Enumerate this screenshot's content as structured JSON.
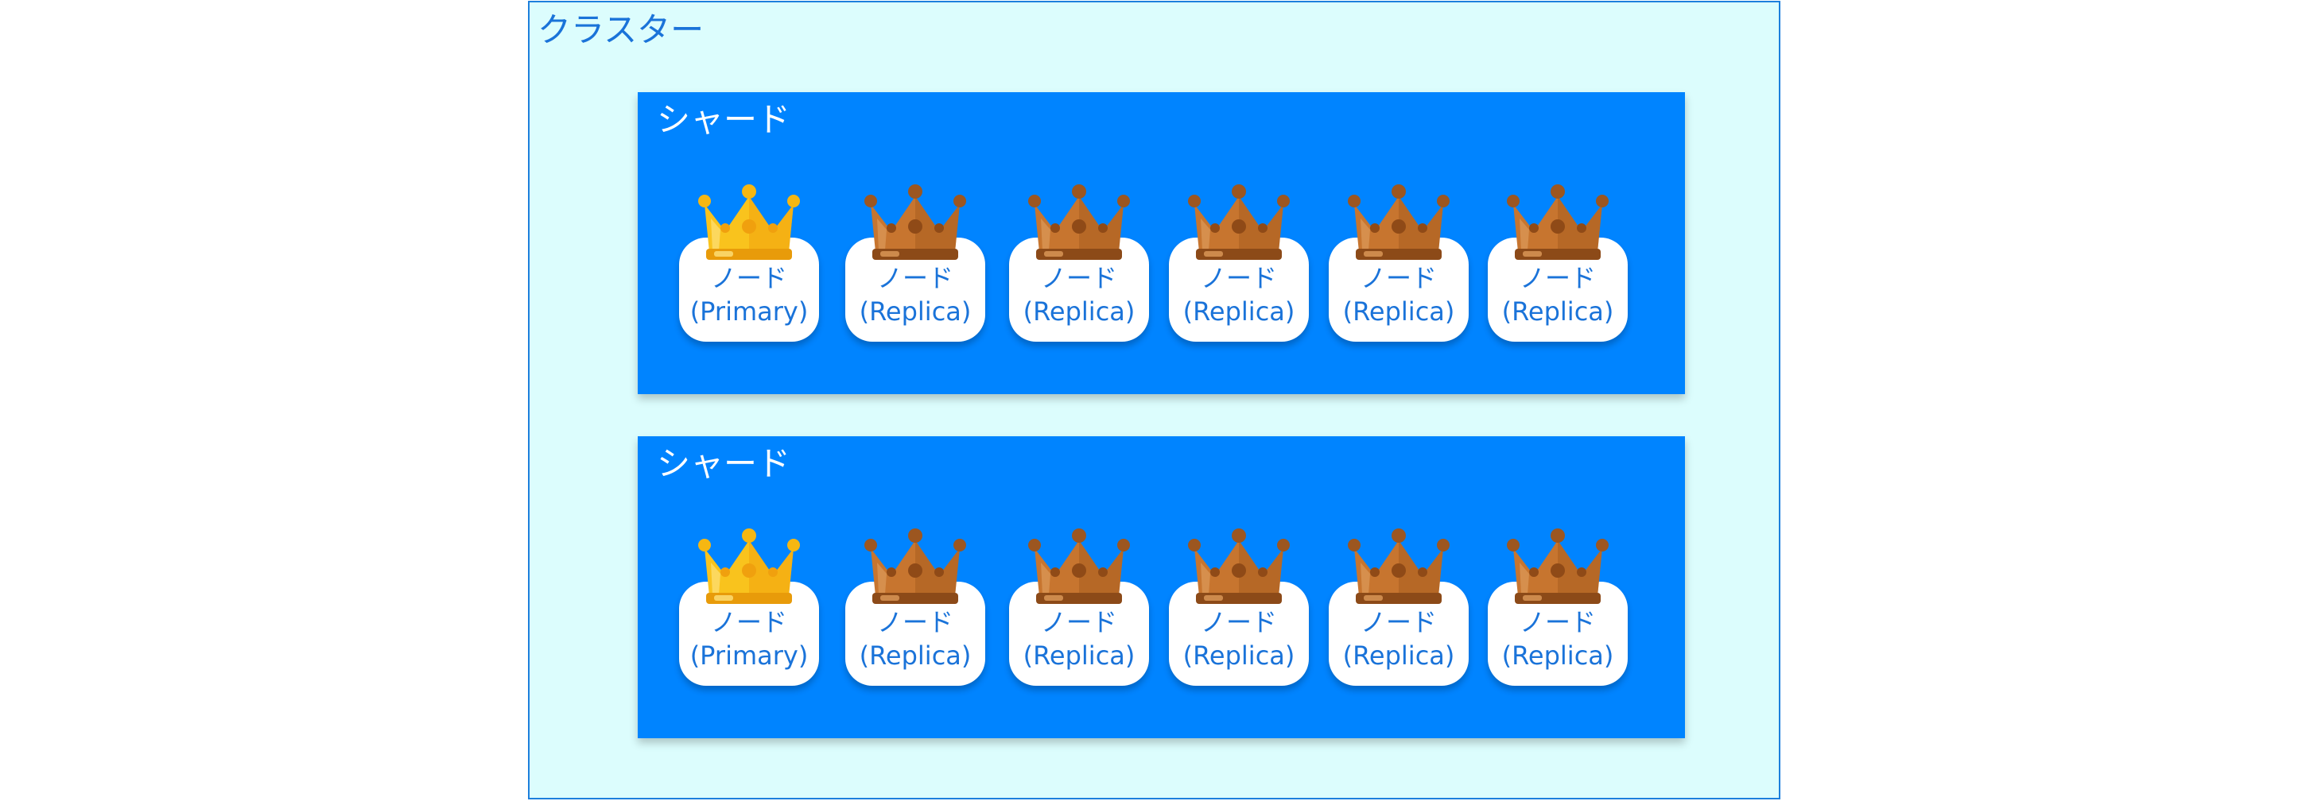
{
  "cluster": {
    "label": "クラスター"
  },
  "shards": [
    {
      "label": "シャード",
      "nodes": [
        {
          "line1": "ノード",
          "line2": "(Primary)",
          "role": "primary",
          "crown_icon": "gold-crown-icon"
        },
        {
          "line1": "ノード",
          "line2": "(Replica)",
          "role": "replica",
          "crown_icon": "bronze-crown-icon"
        },
        {
          "line1": "ノード",
          "line2": "(Replica)",
          "role": "replica",
          "crown_icon": "bronze-crown-icon"
        },
        {
          "line1": "ノード",
          "line2": "(Replica)",
          "role": "replica",
          "crown_icon": "bronze-crown-icon"
        },
        {
          "line1": "ノード",
          "line2": "(Replica)",
          "role": "replica",
          "crown_icon": "bronze-crown-icon"
        },
        {
          "line1": "ノード",
          "line2": "(Replica)",
          "role": "replica",
          "crown_icon": "bronze-crown-icon"
        }
      ]
    },
    {
      "label": "シャード",
      "nodes": [
        {
          "line1": "ノード",
          "line2": "(Primary)",
          "role": "primary",
          "crown_icon": "gold-crown-icon"
        },
        {
          "line1": "ノード",
          "line2": "(Replica)",
          "role": "replica",
          "crown_icon": "bronze-crown-icon"
        },
        {
          "line1": "ノード",
          "line2": "(Replica)",
          "role": "replica",
          "crown_icon": "bronze-crown-icon"
        },
        {
          "line1": "ノード",
          "line2": "(Replica)",
          "role": "replica",
          "crown_icon": "bronze-crown-icon"
        },
        {
          "line1": "ノード",
          "line2": "(Replica)",
          "role": "replica",
          "crown_icon": "bronze-crown-icon"
        },
        {
          "line1": "ノード",
          "line2": "(Replica)",
          "role": "replica",
          "crown_icon": "bronze-crown-icon"
        }
      ]
    }
  ],
  "colors": {
    "cluster_background": "#dcfdfd",
    "cluster_border": "#1d7fdc",
    "shard_background": "#0084ff",
    "node_background": "#ffffff",
    "node_text": "#1a73d9",
    "gold_crown": "#f9c31d",
    "bronze_crown": "#c7752f"
  }
}
